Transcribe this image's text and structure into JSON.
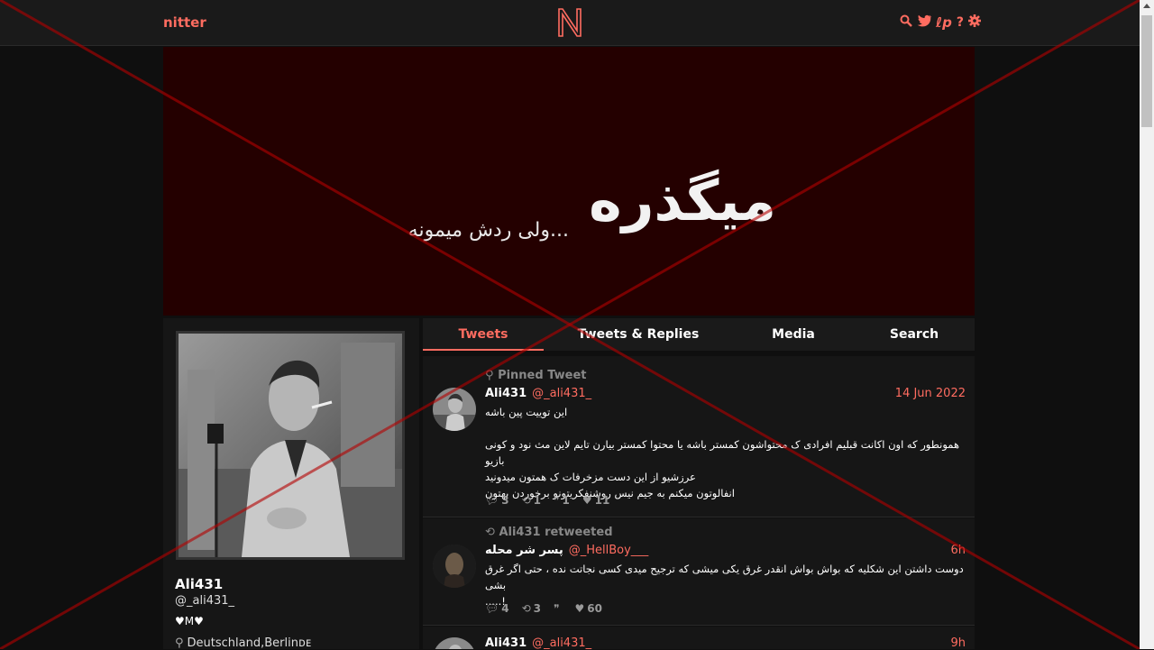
{
  "nav": {
    "brand": "nitter",
    "logo_letter": "N",
    "icons": [
      "search-icon",
      "twitter-icon",
      "rss-icon",
      "help-icon",
      "settings-icon"
    ]
  },
  "banner": {
    "main_text": "میگذره",
    "sub_text": "ولی ردش میمونه..."
  },
  "profile": {
    "fullname": "Ali431",
    "username": "@_ali431_",
    "bio": "♥M♥",
    "location": "Deutschland,Berlinᴅᴇ"
  },
  "tabs": [
    {
      "label": "Tweets",
      "active": true
    },
    {
      "label": "Tweets & Replies",
      "active": false
    },
    {
      "label": "Media",
      "active": false
    },
    {
      "label": "Search",
      "active": false
    }
  ],
  "tweets": [
    {
      "header": "Pinned Tweet",
      "fullname": "Ali431",
      "username": "@_ali431_",
      "date": "14 Jun 2022",
      "lines": [
        "این توییت پین باشه",
        "",
        "همونطور که اون اکانت قبلیم افرادی ک محتواشون کمستر باشه یا محتوا کمستر بیارن تایم لاین مث نود و کونی بازیو",
        "عرزشیو از این دست مزخرفات ک همتون میدونید",
        "انفالوتون میکنم به جیم نیس روشنفکریتونو برخوردن بهتون"
      ],
      "replies": "3",
      "retweets": "1",
      "quotes": "1",
      "likes": "11"
    },
    {
      "header": "Ali431 retweeted",
      "fullname": "پسر شر محله",
      "username": "@_HellBoy___",
      "date": "6h",
      "lines": [
        "دوست داشتن این شکلیه که بواش بواش انقدر غرق یکی میشی که ترجیح میدی کسی نجاتت نده ، حتی اگر غرق بشی",
        "!....."
      ],
      "replies": "4",
      "retweets": "3",
      "quotes": "",
      "likes": "60"
    },
    {
      "header": "",
      "fullname": "Ali431",
      "username": "@_ali431_",
      "date": "9h",
      "lines": [],
      "replies": "",
      "retweets": "",
      "quotes": "",
      "likes": ""
    }
  ],
  "colors": {
    "accent": "#ff6c60",
    "background": "#0f0f0f",
    "panel": "#161616",
    "banner": "#240000",
    "overlay_x": "#b40000"
  }
}
